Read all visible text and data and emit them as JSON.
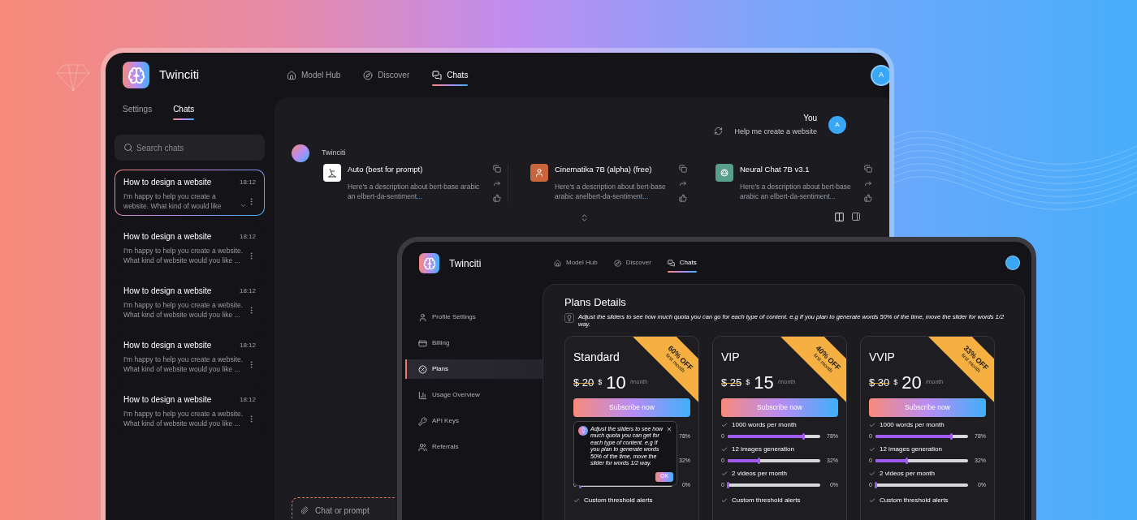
{
  "back_window": {
    "app_name": "Twinciti",
    "nav": [
      {
        "label": "Model Hub",
        "selected": false
      },
      {
        "label": "Discover",
        "selected": false
      },
      {
        "label": "Chats",
        "selected": true
      }
    ],
    "avatar": "A",
    "sidebar_tabs": [
      {
        "label": "Settings",
        "selected": false
      },
      {
        "label": "Chats",
        "selected": true
      }
    ],
    "search": {
      "placeholder": "Search chats"
    },
    "chats": [
      {
        "title": "How to design a website",
        "time": "18:12",
        "preview": "I'm happy to help you create a website. What kind of would like",
        "expanded": false,
        "selected": true
      },
      {
        "title": "How to design a website",
        "time": "18:12",
        "preview": "I'm happy to help you create a website. What kind of website would you like ...",
        "selected": false
      },
      {
        "title": "How to design a website",
        "time": "18:12",
        "preview": "I'm happy to help you create a website. What kind of website would you like ...",
        "selected": false
      },
      {
        "title": "How to design a website",
        "time": "18:12",
        "preview": "I'm happy to help you create a website. What kind of website would you like ...",
        "selected": false
      },
      {
        "title": "How to design a website",
        "time": "18:12",
        "preview": "I'm happy to help you create a website. What kind of website would you like ...",
        "selected": false
      }
    ],
    "user_message": {
      "sender": "You",
      "text": "Help me create a website",
      "avatar": "A"
    },
    "bot": {
      "name": "Twinciti",
      "responses": [
        {
          "model": "Auto (best for prompt)",
          "text": "Here's a description about bert-base arabic an elbert-da-sentiment",
          "more": "..."
        },
        {
          "model": "Cinematika 7B (alpha) (free)",
          "text": "Here's a description about bert-base arabic anelbert-da-sentiment",
          "more": "..."
        },
        {
          "model": "Neural Chat 7B v3.1",
          "text": "Here's a description about bert-base arabic an elbert-da-sentiment",
          "more": "..."
        }
      ]
    },
    "composer": {
      "placeholder": "Chat or prompt"
    }
  },
  "front_window": {
    "app_name": "Twinciti",
    "nav": [
      {
        "label": "Model Hub",
        "selected": false
      },
      {
        "label": "Discover",
        "selected": false
      },
      {
        "label": "Chats",
        "selected": true
      }
    ],
    "sidebar": [
      {
        "label": "Profile Settings",
        "selected": false
      },
      {
        "label": "Billing",
        "selected": false
      },
      {
        "label": "Plans",
        "selected": true
      },
      {
        "label": "Usage Overview",
        "selected": false
      },
      {
        "label": "API Keys",
        "selected": false
      },
      {
        "label": "Referrals",
        "selected": false
      }
    ],
    "title": "Plans Details",
    "note": "Adjust the sliders to see how much quota you can go for each type of content. e.g If you plan to generate words 50% of the time, move the slider for words 1/2 way.",
    "plans": [
      {
        "name": "Standard",
        "old_price": "$ 20",
        "currency": "$",
        "price": "10",
        "period": "/month",
        "discount": "60% OFF",
        "discount_note": "first month",
        "button": "Subscribe now",
        "tooltip": {
          "text": "Adjust the sliders to see how much quota you can get for each type of content. e.g If you plan to generate words 50% of the time, move the slider for words 1/2 way.",
          "button": "OK"
        },
        "features": [
          {
            "reading": "78%"
          },
          {
            "reading": "32%"
          },
          {
            "min": "0",
            "level": 0,
            "reading": "0%"
          }
        ],
        "extra": "Custom threshold alerts"
      },
      {
        "name": "VIP",
        "old_price": "$ 25",
        "currency": "$",
        "price": "15",
        "period": "/month",
        "discount": "40% OFF",
        "discount_note": "first month",
        "button": "Subscribe now",
        "features": [
          {
            "label": "1000 words per month",
            "min": "0",
            "level": 0.82,
            "reading": "78%"
          },
          {
            "label": "12 images generation",
            "min": "0",
            "level": 0.33,
            "reading": "32%"
          },
          {
            "label": "2 videos per month",
            "min": "0",
            "level": 0,
            "reading": "0%"
          }
        ],
        "extra": "Custom threshold alerts"
      },
      {
        "name": "VVIP",
        "old_price": "$ 30",
        "currency": "$",
        "price": "20",
        "period": "/month",
        "discount": "33% OFF",
        "discount_note": "first month",
        "button": "Subscribe now",
        "features": [
          {
            "label": "1000 words per month",
            "min": "0",
            "level": 0.82,
            "reading": "78%"
          },
          {
            "label": "12 images generation",
            "min": "0",
            "level": 0.33,
            "reading": "32%"
          },
          {
            "label": "2 videos per month",
            "min": "0",
            "level": 0,
            "reading": "0%"
          }
        ],
        "extra": "Custom threshold alerts"
      }
    ]
  }
}
